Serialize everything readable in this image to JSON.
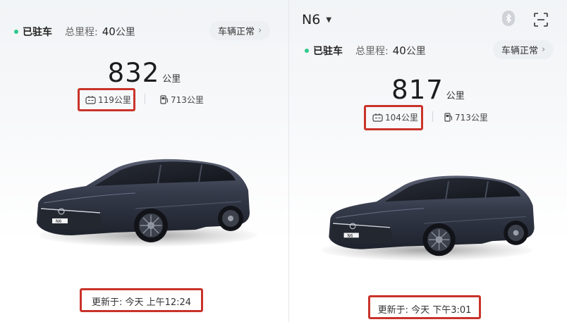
{
  "left": {
    "status": "已驻车",
    "odometer_label": "总里程:",
    "odometer_value": "40",
    "odometer_unit": "公里",
    "health_label": "车辆正常",
    "range_value": "832",
    "range_unit": "公里",
    "battery_range": "119公里",
    "fuel_range": "713公里",
    "car_badge": "N6",
    "updated": "更新于: 今天  上午12:24"
  },
  "right": {
    "model_name": "N6",
    "status": "已驻车",
    "odometer_label": "总里程:",
    "odometer_value": "40",
    "odometer_unit": "公里",
    "health_label": "车辆正常",
    "range_value": "817",
    "range_unit": "公里",
    "battery_range": "104公里",
    "fuel_range": "713公里",
    "car_badge": "N6",
    "updated": "更新于: 今天  下午3:01"
  },
  "icons": {
    "dropdown": "caret-down-icon",
    "bluetooth": "bluetooth-icon",
    "scan": "scan-icon",
    "battery": "battery-icon",
    "fuel": "fuel-pump-icon",
    "chevron": "chevron-right-icon"
  },
  "colors": {
    "parked_dot": "#2ec98b",
    "highlight_box": "#c9332a",
    "car_body": "#2f3444"
  }
}
